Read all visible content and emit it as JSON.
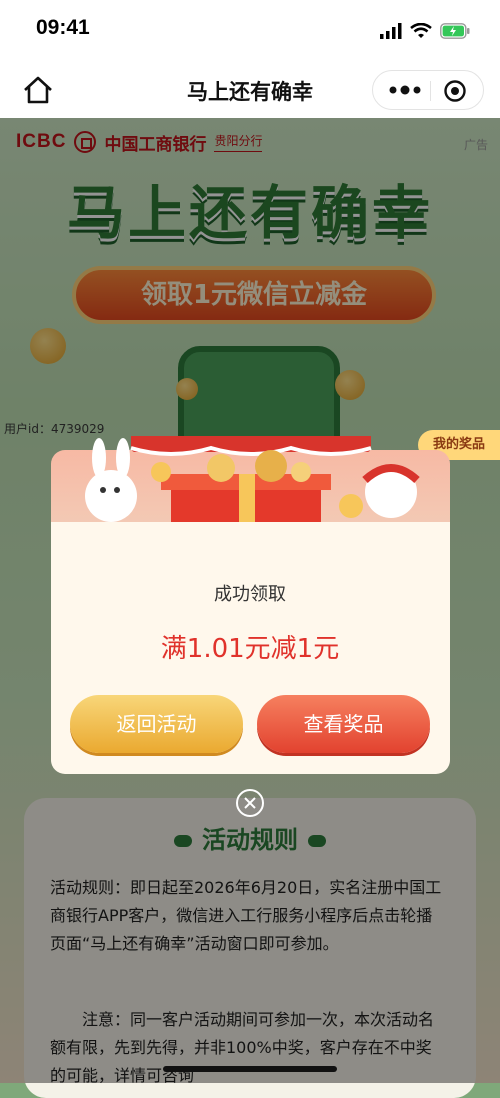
{
  "status_bar": {
    "time": "09:41"
  },
  "nav": {
    "title": "马上还有确幸"
  },
  "page": {
    "bank_short": "ICBC",
    "bank_name": "中国工商银行",
    "branch": "贵阳分行",
    "ad_label": "广告",
    "hero_title": "马上还有确幸",
    "hero_subtitle": "领取1元微信立减金",
    "user_id": "用户id：4739029",
    "my_prizes": "我的奖品",
    "rules": {
      "title": "活动规则",
      "paragraph1": "活动规则：即日起至2026年6月20日，实名注册中国工商银行APP客户，微信进入工行服务小程序后点击轮播页面“马上还有确幸”活动窗口即可参加。",
      "paragraph2": "注意：同一客户活动期间可参加一次，本次活动名额有限，先到先得，并非100%中奖，客户存在不中奖的可能，详情可咨询"
    }
  },
  "modal": {
    "status": "成功领取",
    "prize": "满1.01元减1元",
    "back_button": "返回活动",
    "view_prize_button": "查看奖品"
  },
  "icons": [
    "home-icon",
    "more-icon",
    "target-icon",
    "close-icon",
    "signal-icon",
    "wifi-icon",
    "battery-icon"
  ],
  "colors": {
    "accent_red": "#e0322b",
    "gold": "#eaa930",
    "green": "#2d7a3b"
  }
}
